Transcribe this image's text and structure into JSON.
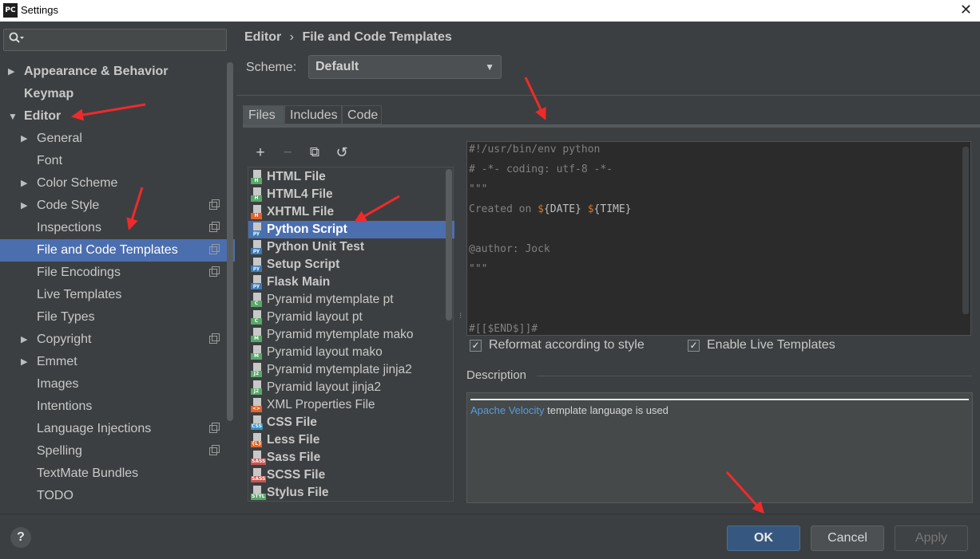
{
  "window": {
    "app_icon": "PC",
    "title": "Settings",
    "close_glyph": "✕"
  },
  "search": {
    "placeholder": ""
  },
  "sidebar": {
    "items": [
      {
        "label": "Appearance & Behavior",
        "level": 0,
        "arrow": "▶",
        "bold": true
      },
      {
        "label": "Keymap",
        "level": 0,
        "arrow": "",
        "bold": true
      },
      {
        "label": "Editor",
        "level": 0,
        "arrow": "▼",
        "bold": true
      },
      {
        "label": "General",
        "level": 1,
        "arrow": "▶"
      },
      {
        "label": "Font",
        "level": 1,
        "arrow": ""
      },
      {
        "label": "Color Scheme",
        "level": 1,
        "arrow": "▶"
      },
      {
        "label": "Code Style",
        "level": 1,
        "arrow": "▶",
        "copy": true
      },
      {
        "label": "Inspections",
        "level": 1,
        "arrow": "",
        "copy": true
      },
      {
        "label": "File and Code Templates",
        "level": 1,
        "arrow": "",
        "copy": true,
        "selected": true
      },
      {
        "label": "File Encodings",
        "level": 1,
        "arrow": "",
        "copy": true
      },
      {
        "label": "Live Templates",
        "level": 1,
        "arrow": ""
      },
      {
        "label": "File Types",
        "level": 1,
        "arrow": ""
      },
      {
        "label": "Copyright",
        "level": 1,
        "arrow": "▶",
        "copy": true
      },
      {
        "label": "Emmet",
        "level": 1,
        "arrow": "▶"
      },
      {
        "label": "Images",
        "level": 1,
        "arrow": ""
      },
      {
        "label": "Intentions",
        "level": 1,
        "arrow": ""
      },
      {
        "label": "Language Injections",
        "level": 1,
        "arrow": "",
        "copy": true
      },
      {
        "label": "Spelling",
        "level": 1,
        "arrow": "",
        "copy": true
      },
      {
        "label": "TextMate Bundles",
        "level": 1,
        "arrow": ""
      },
      {
        "label": "TODO",
        "level": 1,
        "arrow": ""
      }
    ]
  },
  "breadcrumb": {
    "parent": "Editor",
    "sep": "›",
    "current": "File and Code Templates"
  },
  "scheme": {
    "label": "Scheme:",
    "value": "Default"
  },
  "tabs": [
    {
      "label": "Files",
      "active": true
    },
    {
      "label": "Includes"
    },
    {
      "label": "Code"
    }
  ],
  "toolbar": {
    "add": "+",
    "remove": "−",
    "copy": "⧉",
    "reset": "↺"
  },
  "templates": [
    {
      "name": "HTML File",
      "bold": true,
      "icon_text": "H",
      "icon_color": "#59a869"
    },
    {
      "name": "HTML4 File",
      "bold": true,
      "icon_text": "H",
      "icon_color": "#59a869"
    },
    {
      "name": "XHTML File",
      "bold": true,
      "icon_text": "H",
      "icon_color": "#e0642c"
    },
    {
      "name": "Python Script",
      "bold": true,
      "icon_text": "py",
      "icon_color": "#3b78b7",
      "selected": true
    },
    {
      "name": "Python Unit Test",
      "bold": true,
      "icon_text": "py",
      "icon_color": "#3b78b7"
    },
    {
      "name": "Setup Script",
      "bold": true,
      "icon_text": "py",
      "icon_color": "#3b78b7"
    },
    {
      "name": "Flask Main",
      "bold": true,
      "icon_text": "py",
      "icon_color": "#3b78b7"
    },
    {
      "name": "Pyramid mytemplate pt",
      "icon_text": "C",
      "icon_color": "#59a869"
    },
    {
      "name": "Pyramid layout pt",
      "icon_text": "C",
      "icon_color": "#59a869"
    },
    {
      "name": "Pyramid mytemplate mako",
      "icon_text": "M",
      "icon_color": "#59a869"
    },
    {
      "name": "Pyramid layout mako",
      "icon_text": "M",
      "icon_color": "#59a869"
    },
    {
      "name": "Pyramid mytemplate jinja2",
      "icon_text": "J2",
      "icon_color": "#59a869"
    },
    {
      "name": "Pyramid layout jinja2",
      "icon_text": "J2",
      "icon_color": "#59a869"
    },
    {
      "name": "XML Properties File",
      "icon_text": "<>",
      "icon_color": "#e0642c"
    },
    {
      "name": "CSS File",
      "bold": true,
      "icon_text": "CSS",
      "icon_color": "#3592c4"
    },
    {
      "name": "Less File",
      "bold": true,
      "icon_text": "{L}",
      "icon_color": "#e0642c"
    },
    {
      "name": "Sass File",
      "bold": true,
      "icon_text": "SASS",
      "icon_color": "#c75450"
    },
    {
      "name": "SCSS File",
      "bold": true,
      "icon_text": "SASS",
      "icon_color": "#c75450"
    },
    {
      "name": "Stylus File",
      "bold": true,
      "icon_text": "STYL",
      "icon_color": "#59a869"
    }
  ],
  "editor": {
    "lines": [
      {
        "row": 0,
        "text": "#!/usr/bin/env python"
      },
      {
        "row": 1,
        "text": "# -*- coding: utf-8 -*-"
      },
      {
        "row": 2,
        "text": "\"\"\""
      },
      {
        "row": 3,
        "prefix": "Created on ",
        "d1": "$",
        "v1": "{DATE}",
        "mid": " ",
        "d2": "$",
        "v2": "{TIME}"
      },
      {
        "row": 5,
        "text": "@author: Jock"
      },
      {
        "row": 6,
        "text": "\"\"\""
      },
      {
        "row": 9,
        "text": "#[[$END$]]#"
      }
    ]
  },
  "options": {
    "reformat": {
      "label": "Reformat according to style",
      "checked": true
    },
    "live_templates": {
      "label": "Enable Live Templates",
      "checked": true
    },
    "check_glyph": "✓"
  },
  "description": {
    "label": "Description",
    "link": "Apache Velocity",
    "text": " template language is used"
  },
  "footer": {
    "help": "?",
    "ok": "OK",
    "cancel": "Cancel",
    "apply": "Apply"
  },
  "colors": {
    "selection": "#4b6eaf",
    "annotation_red": "#f02a2a"
  }
}
